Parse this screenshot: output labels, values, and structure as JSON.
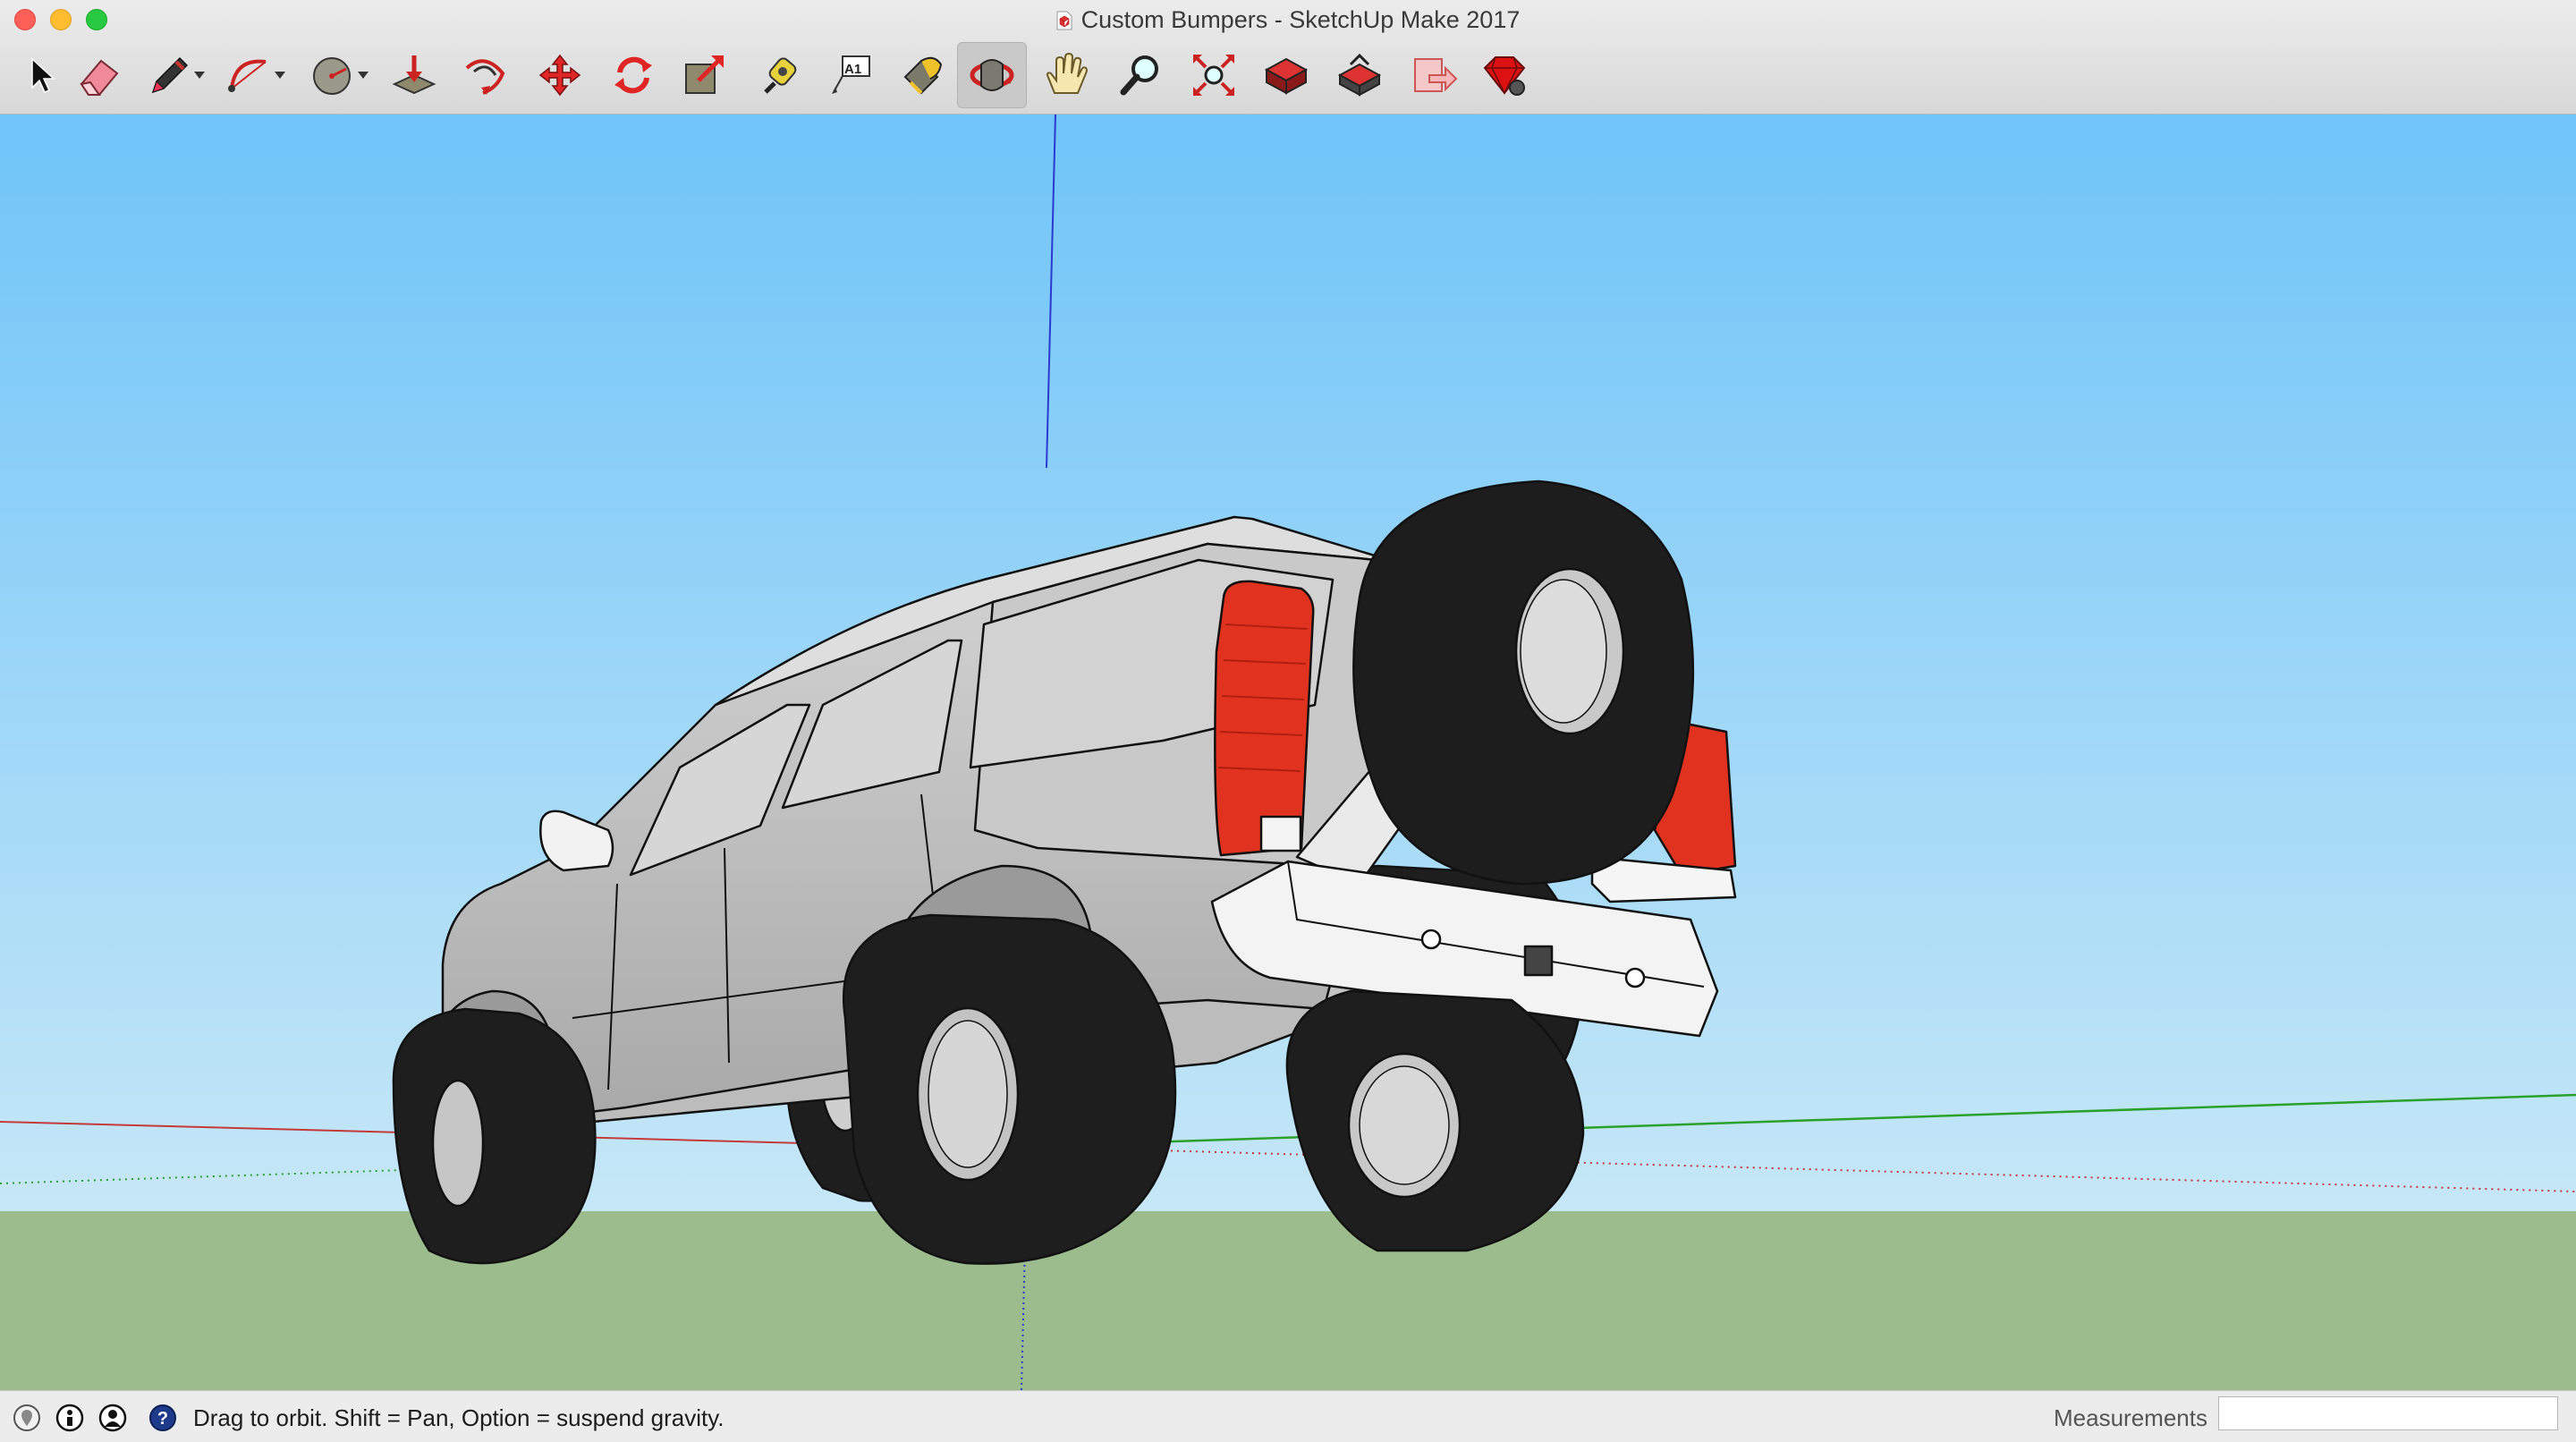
{
  "window": {
    "title": "Custom Bumpers - SketchUp Make 2017",
    "title_icon": "sketchup-document-icon",
    "traffic_lights": [
      "close",
      "minimize",
      "zoom"
    ]
  },
  "toolbar": {
    "tools": [
      {
        "name": "select",
        "icon": "arrow-cursor-icon",
        "active": false,
        "dropdown": false
      },
      {
        "name": "eraser",
        "icon": "eraser-icon",
        "active": false,
        "dropdown": false
      },
      {
        "name": "line",
        "icon": "pencil-icon",
        "active": false,
        "dropdown": true
      },
      {
        "name": "arc",
        "icon": "arc-icon",
        "active": false,
        "dropdown": true
      },
      {
        "name": "shapes",
        "icon": "circle-shape-icon",
        "active": false,
        "dropdown": true
      },
      {
        "name": "push-pull",
        "icon": "push-pull-icon",
        "active": false,
        "dropdown": false
      },
      {
        "name": "offset",
        "icon": "offset-icon",
        "active": false,
        "dropdown": false
      },
      {
        "name": "move",
        "icon": "move-arrows-icon",
        "active": false,
        "dropdown": false
      },
      {
        "name": "rotate",
        "icon": "rotate-icon",
        "active": false,
        "dropdown": false
      },
      {
        "name": "scale",
        "icon": "scale-icon",
        "active": false,
        "dropdown": false
      },
      {
        "name": "tape-measure",
        "icon": "tape-measure-icon",
        "active": false,
        "dropdown": false
      },
      {
        "name": "text",
        "icon": "text-label-icon",
        "text": "A1",
        "active": false,
        "dropdown": false
      },
      {
        "name": "paint-bucket",
        "icon": "paint-bucket-icon",
        "active": false,
        "dropdown": false
      },
      {
        "name": "orbit",
        "icon": "orbit-icon",
        "active": true,
        "dropdown": false
      },
      {
        "name": "pan",
        "icon": "hand-icon",
        "active": false,
        "dropdown": false
      },
      {
        "name": "zoom",
        "icon": "magnifier-icon",
        "active": false,
        "dropdown": false
      },
      {
        "name": "zoom-extents",
        "icon": "zoom-extents-icon",
        "active": false,
        "dropdown": false
      },
      {
        "name": "3d-warehouse",
        "icon": "warehouse-icon",
        "active": false,
        "dropdown": false
      },
      {
        "name": "share-model",
        "icon": "share-model-icon",
        "active": false,
        "dropdown": false
      },
      {
        "name": "send-to-layout",
        "icon": "layout-icon",
        "active": false,
        "dropdown": false
      },
      {
        "name": "extension-warehouse",
        "icon": "ruby-gem-icon",
        "active": false,
        "dropdown": false
      }
    ]
  },
  "viewport": {
    "sky_colors": [
      "#6fc4f8",
      "#c6e7f7"
    ],
    "ground_color": "#9cbc8e",
    "axis_colors": {
      "red": "#c43a3a",
      "green": "#2aa12a",
      "blue": "#2a3ad0"
    }
  },
  "statusbar": {
    "icons": [
      "geo-location-icon",
      "credits-icon",
      "user-account-icon",
      "help-icon"
    ],
    "message": "Drag to orbit. Shift = Pan, Option = suspend gravity.",
    "measurements_label": "Measurements",
    "measurements_value": ""
  }
}
